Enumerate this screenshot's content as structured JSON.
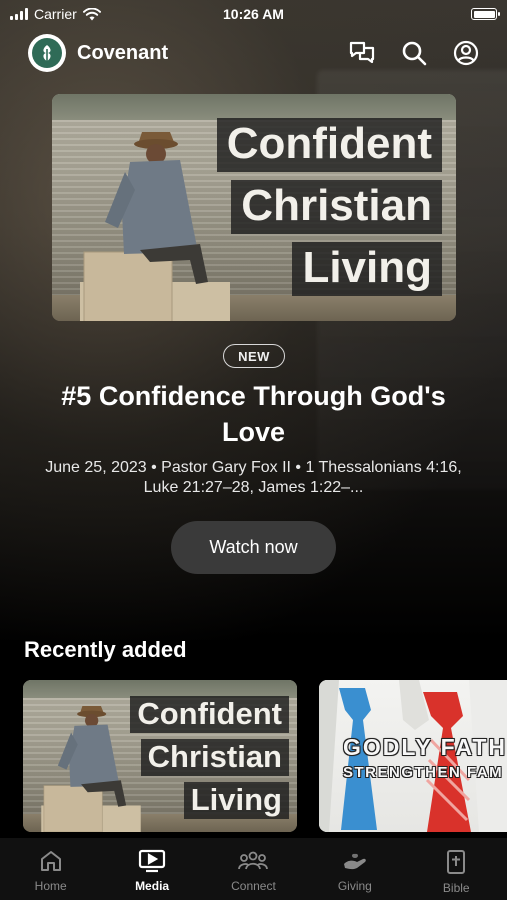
{
  "status_bar": {
    "carrier": "Carrier",
    "time": "10:26 AM"
  },
  "header": {
    "brand": "Covenant",
    "actions": [
      {
        "icon": "chat-bubbles-icon"
      },
      {
        "icon": "search-icon"
      },
      {
        "icon": "profile-icon"
      }
    ]
  },
  "hero": {
    "image_title_lines": [
      "Confident",
      "Christian",
      "Living"
    ],
    "badge": "NEW",
    "title": "#5 Confidence Through God's Love",
    "meta": "June 25, 2023 • Pastor Gary Fox II • 1 Thessalonians 4:16, Luke 21:27–28, James 1:22–...",
    "cta": "Watch now"
  },
  "recently_added": {
    "heading": "Recently added",
    "items": [
      {
        "title_lines": [
          "Confident",
          "Christian",
          "Living"
        ]
      },
      {
        "line1": "GODLY FATH",
        "line2": "STRENGTHEN FAM"
      }
    ]
  },
  "tabs": [
    {
      "label": "Home",
      "icon": "home-icon",
      "active": false
    },
    {
      "label": "Media",
      "icon": "media-icon",
      "active": true
    },
    {
      "label": "Connect",
      "icon": "connect-icon",
      "active": false
    },
    {
      "label": "Giving",
      "icon": "giving-icon",
      "active": false
    },
    {
      "label": "Bible",
      "icon": "bible-icon",
      "active": false
    }
  ],
  "colors": {
    "accent": "#2f6b57",
    "button_bg": "#3a3a3a",
    "tab_inactive": "#8a8a8a"
  }
}
